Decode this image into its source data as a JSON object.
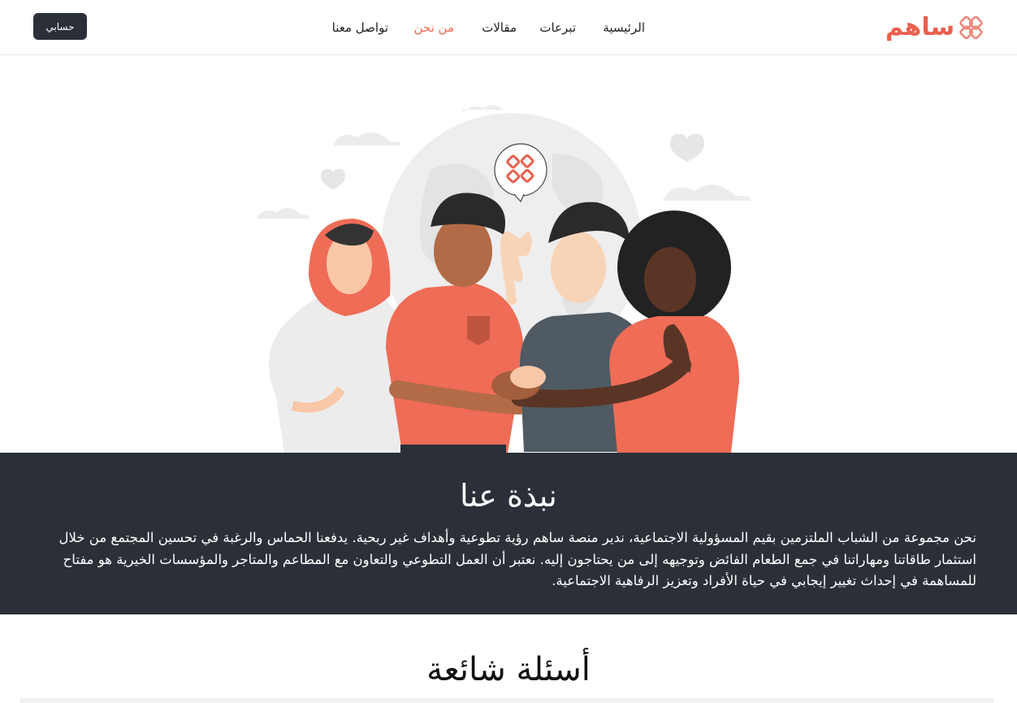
{
  "brand": {
    "name": "ساهم",
    "color": "#e8614f"
  },
  "nav": {
    "items": [
      {
        "label": "الرئيسية",
        "active": false
      },
      {
        "label": "تبرعات",
        "active": false
      },
      {
        "label": "مقالات",
        "active": false
      },
      {
        "label": "من نحن",
        "active": true
      },
      {
        "label": "تواصل معنا",
        "active": false
      }
    ],
    "account_label": "حسابي"
  },
  "hero": {
    "illustration": "volunteers-hands-together",
    "badge_icon": "brand-logo-icon"
  },
  "about": {
    "title": "نبذة عنا",
    "text": "نحن مجموعة من الشباب الملتزمين بقيم المسؤولية الاجتماعية، ندير منصة ساهم رؤية تطوعية وأهداف غير ربحية. يدفعنا الحماس والرغبة في تحسين المجتمع من خلال استثمار طاقاتنا ومهاراتنا في جمع الطعام الفائض وتوجيهه إلى من يحتاجون إليه. نعتبر أن العمل التطوعي والتعاون مع المطاعم والمتاجر والمؤسسات الخيرية هو مفتاح للمساهمة في إحداث تغيير إيجابي في حياة الأفراد وتعزيز الرفاهية الاجتماعية."
  },
  "faq": {
    "title": "أسئلة شائعة"
  },
  "colors": {
    "accent": "#ef6c57",
    "dark": "#2b3038"
  }
}
